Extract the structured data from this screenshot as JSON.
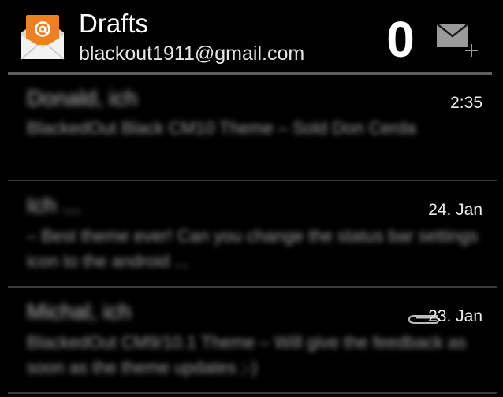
{
  "header": {
    "title": "Drafts",
    "account": "blackout1911@gmail.com",
    "unread_count": "0",
    "app_icon": "gmail-envelope-icon",
    "compose_icon": "compose-mail-icon"
  },
  "messages": [
    {
      "sender": "Donald, ich",
      "preview": "BlackedOut Black CM10 Theme – Sold Don Cerda",
      "date": "2:35",
      "has_attachment": false
    },
    {
      "sender": "Ich ...",
      "preview": "– Best theme ever! Can you change the status bar settings icon to the android ...",
      "date": "24. Jan",
      "has_attachment": false
    },
    {
      "sender": "Michal, ich",
      "preview": "BlackedOut CM9/10.1 Theme – Will give the feedback as soon as the theme updates ;-)",
      "date": "23. Jan",
      "has_attachment": true,
      "attachment_icon": "paperclip-icon"
    }
  ],
  "colors": {
    "background": "#000000",
    "icon_orange": "#f0801f",
    "rule": "#5f5f5f",
    "divider": "#3b3b3b"
  }
}
